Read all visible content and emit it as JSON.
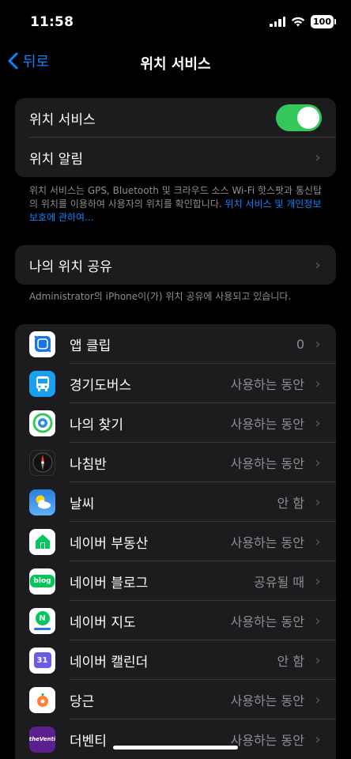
{
  "status": {
    "time": "11:58",
    "battery": "100"
  },
  "nav": {
    "back_label": "뒤로",
    "title": "위치 서비스"
  },
  "location": {
    "toggle_label": "위치 서비스",
    "toggle_on": true,
    "alerts_label": "위치 알림"
  },
  "footnote1": {
    "text": "위치 서비스는 GPS, Bluetooth 및 크라우드 소스 Wi-Fi 핫스팟과 통신탑의 위치를 이용하여 사용자의 위치를 확인합니다.",
    "link": "위치 서비스 및 개인정보 보호에 관하여..."
  },
  "share": {
    "label": "나의 위치 공유"
  },
  "footnote2": "Administrator의 iPhone이(가) 위치 공유에 사용되고 있습니다.",
  "apps": [
    {
      "name": "앱 클립",
      "value": "0",
      "icon": "app-clip-icon",
      "color": "#ffffff"
    },
    {
      "name": "경기도버스",
      "value": "사용하는 동안",
      "icon": "bus-icon",
      "color": "#1aa0f2"
    },
    {
      "name": "나의 찾기",
      "value": "사용하는 동안",
      "icon": "find-my-icon",
      "color": "#ffffff"
    },
    {
      "name": "나침반",
      "value": "사용하는 동안",
      "icon": "compass-icon",
      "color": "#1c1c1e"
    },
    {
      "name": "날씨",
      "value": "안 함",
      "icon": "weather-icon",
      "color": "#3a8ee6"
    },
    {
      "name": "네이버 부동산",
      "value": "사용하는 동안",
      "icon": "naver-realestate-icon",
      "color": "#ffffff"
    },
    {
      "name": "네이버 블로그",
      "value": "공유될 때",
      "icon": "naver-blog-icon",
      "color": "#ffffff"
    },
    {
      "name": "네이버 지도",
      "value": "사용하는 동안",
      "icon": "naver-map-icon",
      "color": "#ffffff"
    },
    {
      "name": "네이버 캘린더",
      "value": "안 함",
      "icon": "naver-calendar-icon",
      "color": "#ffffff"
    },
    {
      "name": "당근",
      "value": "사용하는 동안",
      "icon": "daangn-icon",
      "color": "#ffffff"
    },
    {
      "name": "더벤티",
      "value": "사용하는 동안",
      "icon": "theventi-icon",
      "color": "#5b1f8f"
    }
  ],
  "icon_text": {
    "bus": "BUS",
    "blog": "blog",
    "map": "N",
    "calendar": "31",
    "venti": "theVenti"
  },
  "colors": {
    "accent": "#0a84ff",
    "toggle_on": "#34c759",
    "cell": "#1c1c1e"
  }
}
